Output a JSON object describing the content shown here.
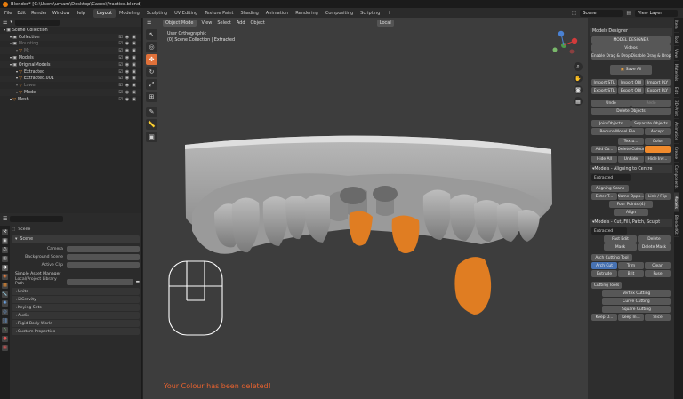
{
  "window": {
    "title": "Blender* [C:\\Users\\umam\\Desktop\\Cases\\Practice.blend]"
  },
  "menus": [
    "File",
    "Edit",
    "Render",
    "Window",
    "Help"
  ],
  "workspaces": [
    "Layout",
    "Modeling",
    "Sculpting",
    "UV Editing",
    "Texture Paint",
    "Shading",
    "Animation",
    "Rendering",
    "Compositing",
    "Scripting"
  ],
  "active_workspace": "Layout",
  "topright": {
    "scene": "Scene",
    "view_layer": "View Layer"
  },
  "outliner": {
    "rows": [
      {
        "label": "Scene Collection",
        "indent": 0,
        "icon": "scene-collection-icon",
        "faded": false
      },
      {
        "label": "Collection",
        "indent": 1,
        "icon": "collection-icon",
        "faded": false
      },
      {
        "label": "Mounting",
        "indent": 1,
        "icon": "collection-icon",
        "faded": true
      },
      {
        "label": "Mt",
        "indent": 2,
        "icon": "object-icon",
        "faded": true
      },
      {
        "label": "Models",
        "indent": 1,
        "icon": "collection-icon",
        "faded": false
      },
      {
        "label": "OriginalModels",
        "indent": 1,
        "icon": "collection-icon",
        "faded": false
      },
      {
        "label": "Extracted",
        "indent": 2,
        "icon": "object-icon",
        "faded": false
      },
      {
        "label": "Extracted.001",
        "indent": 2,
        "icon": "object-icon",
        "faded": false
      },
      {
        "label": "Lower",
        "indent": 2,
        "icon": "object-icon",
        "faded": true
      },
      {
        "label": "Model",
        "indent": 2,
        "icon": "object-icon",
        "faded": false
      },
      {
        "label": "Mesh",
        "indent": 1,
        "icon": "object-icon",
        "faded": false
      }
    ]
  },
  "properties": {
    "breadcrumb": "Scene",
    "panel_title": "Scene",
    "fields": [
      {
        "key": "Camera",
        "value": ""
      },
      {
        "key": "Background Scene",
        "value": ""
      },
      {
        "key": "Active Clip",
        "value": ""
      }
    ],
    "asset_manager": "Simple Asset Manager",
    "library_path_label": "Local/Project Library Path",
    "subpanels": [
      "Units",
      "Gravity",
      "Keying Sets",
      "Audio",
      "Rigid Body World",
      "Custom Properties"
    ]
  },
  "viewport": {
    "mode": "Object Mode",
    "menus": [
      "View",
      "Select",
      "Add",
      "Object"
    ],
    "orientation": "Local",
    "info_line1": "User Orthographic",
    "info_line2": "(0) Scene Collection | Extracted",
    "status_message": "Your Colour has been deleted!"
  },
  "sidebar": {
    "title": "Models Designer",
    "header_btn": "MODEL DESIGNER",
    "videos": "Videos",
    "enable_drag": "Enable Drag & Drop",
    "disable_drag": "Disable Drag & Drop",
    "save_all": "Save All",
    "import": [
      "Import STL",
      "Import OBJ",
      "Import PLY"
    ],
    "export": [
      "Export STL",
      "Export OBJ",
      "Export PLY"
    ],
    "undo": "Undo",
    "redo": "Redo",
    "delete_objects": "Delete Objects",
    "join_objects": "Join Objects",
    "separate_objects": "Separate Objects",
    "reduce_model_file": "Reduce Model File",
    "accept": "Accept",
    "textu": "Textu...",
    "color": "Color",
    "add_co": "Add Co...",
    "delete_colour": "Delete Colour",
    "colour_swatch": "#f08a2c",
    "hide_all": "Hide All",
    "unhide": "Unhide",
    "hide_inv": "Hide Inv...",
    "aligning_hdr": "Models - Aligning to Centre",
    "extracted": "Extracted",
    "aligning_scans": "Aligning Scans",
    "enter_t": "Enter T...",
    "name_opp": "Name Oppo...",
    "link_flip": "Link / Flip",
    "four_points": "Four Points (4)",
    "align": "Align",
    "cut_fill_hdr": "Models - Cut, Fill, Patch, Sculpt",
    "fast_edit": "Fast Edit",
    "delete": "Delete",
    "mask": "Mask",
    "delete_mask": "Delete Mask",
    "arch_cutting_tool": "Arch Cutting Tool",
    "arch_cut": "Arch Cut",
    "trim": "Trim",
    "clean": "Clean",
    "extrude": "Extrude",
    "brit": "Brit",
    "fuse": "Fuse",
    "cutting_tools": "Cutting Tools",
    "vertex_cutting": "Vertex Cutting",
    "curve_cutting": "Curve Cutting",
    "square_cutting": "Square Cutting",
    "keep_o": "Keep O...",
    "keep_in": "Keep In...",
    "slice": "Slice"
  },
  "side_tabs": [
    "Item",
    "Tool",
    "View",
    "Materials",
    "Edit",
    "3D-Print",
    "Animation",
    "Create",
    "Components",
    "Models",
    "BlenderKit"
  ],
  "active_side_tab": "Models"
}
